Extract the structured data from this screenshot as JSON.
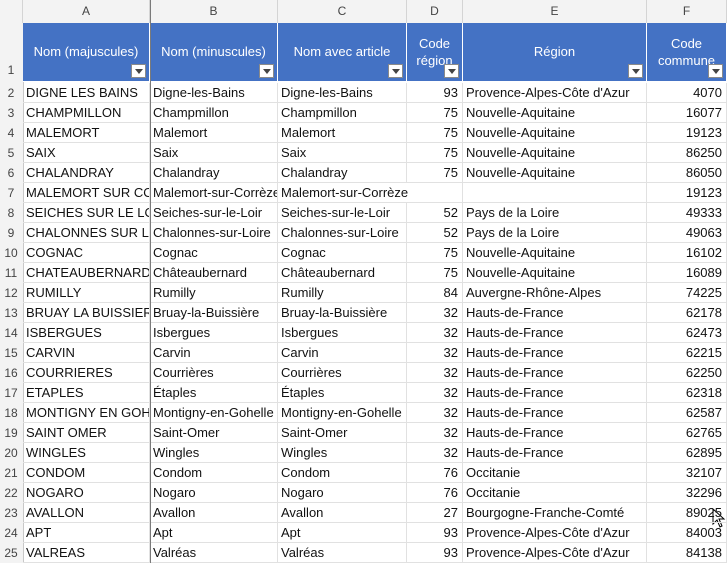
{
  "column_letters": [
    "A",
    "B",
    "C",
    "D",
    "E",
    "F"
  ],
  "headers": {
    "A": [
      "Nom (majuscules)"
    ],
    "B": [
      "Nom (minuscules)"
    ],
    "C": [
      "Nom avec article"
    ],
    "D": [
      "Code",
      "région"
    ],
    "E": [
      "Région"
    ],
    "F": [
      "Code",
      "commune"
    ]
  },
  "header_row_number": "1",
  "rows": [
    {
      "n": "2",
      "a": "DIGNE LES BAINS",
      "b": "Digne-les-Bains",
      "c": "Digne-les-Bains",
      "d": "93",
      "e": "Provence-Alpes-Côte d'Azur",
      "f": "4070"
    },
    {
      "n": "3",
      "a": "CHAMPMILLON",
      "b": "Champmillon",
      "c": "Champmillon",
      "d": "75",
      "e": "Nouvelle-Aquitaine",
      "f": "16077"
    },
    {
      "n": "4",
      "a": "MALEMORT",
      "b": "Malemort",
      "c": "Malemort",
      "d": "75",
      "e": "Nouvelle-Aquitaine",
      "f": "19123"
    },
    {
      "n": "5",
      "a": "SAIX",
      "b": "Saix",
      "c": "Saix",
      "d": "75",
      "e": "Nouvelle-Aquitaine",
      "f": "86250"
    },
    {
      "n": "6",
      "a": "CHALANDRAY",
      "b": "Chalandray",
      "c": "Chalandray",
      "d": "75",
      "e": "Nouvelle-Aquitaine",
      "f": "86050"
    },
    {
      "n": "7",
      "a": "MALEMORT SUR CORRÈZE",
      "b": "Malemort-sur-Corrèze",
      "c": "Malemort-sur-Corrèze",
      "d": "",
      "e": "",
      "f": "19123",
      "c_spill": true
    },
    {
      "n": "8",
      "a": "SEICHES SUR LE LOIR",
      "b": "Seiches-sur-le-Loir",
      "c": "Seiches-sur-le-Loir",
      "d": "52",
      "e": "Pays de la Loire",
      "f": "49333"
    },
    {
      "n": "9",
      "a": "CHALONNES SUR LOIRE",
      "b": "Chalonnes-sur-Loire",
      "c": "Chalonnes-sur-Loire",
      "d": "52",
      "e": "Pays de la Loire",
      "f": "49063"
    },
    {
      "n": "10",
      "a": "COGNAC",
      "b": "Cognac",
      "c": "Cognac",
      "d": "75",
      "e": "Nouvelle-Aquitaine",
      "f": "16102"
    },
    {
      "n": "11",
      "a": "CHATEAUBERNARD",
      "b": "Châteaubernard",
      "c": "Châteaubernard",
      "d": "75",
      "e": "Nouvelle-Aquitaine",
      "f": "16089"
    },
    {
      "n": "12",
      "a": "RUMILLY",
      "b": "Rumilly",
      "c": "Rumilly",
      "d": "84",
      "e": "Auvergne-Rhône-Alpes",
      "f": "74225"
    },
    {
      "n": "13",
      "a": "BRUAY LA BUISSIERE",
      "b": "Bruay-la-Buissière",
      "c": "Bruay-la-Buissière",
      "d": "32",
      "e": "Hauts-de-France",
      "f": "62178"
    },
    {
      "n": "14",
      "a": "ISBERGUES",
      "b": "Isbergues",
      "c": "Isbergues",
      "d": "32",
      "e": "Hauts-de-France",
      "f": "62473"
    },
    {
      "n": "15",
      "a": "CARVIN",
      "b": "Carvin",
      "c": "Carvin",
      "d": "32",
      "e": "Hauts-de-France",
      "f": "62215"
    },
    {
      "n": "16",
      "a": "COURRIERES",
      "b": "Courrières",
      "c": "Courrières",
      "d": "32",
      "e": "Hauts-de-France",
      "f": "62250"
    },
    {
      "n": "17",
      "a": "ETAPLES",
      "b": "Étaples",
      "c": "Étaples",
      "d": "32",
      "e": "Hauts-de-France",
      "f": "62318"
    },
    {
      "n": "18",
      "a": "MONTIGNY EN GOHELLE",
      "b": "Montigny-en-Gohelle",
      "c": "Montigny-en-Gohelle",
      "d": "32",
      "e": "Hauts-de-France",
      "f": "62587"
    },
    {
      "n": "19",
      "a": "SAINT OMER",
      "b": "Saint-Omer",
      "c": "Saint-Omer",
      "d": "32",
      "e": "Hauts-de-France",
      "f": "62765"
    },
    {
      "n": "20",
      "a": "WINGLES",
      "b": "Wingles",
      "c": "Wingles",
      "d": "32",
      "e": "Hauts-de-France",
      "f": "62895"
    },
    {
      "n": "21",
      "a": "CONDOM",
      "b": "Condom",
      "c": "Condom",
      "d": "76",
      "e": "Occitanie",
      "f": "32107"
    },
    {
      "n": "22",
      "a": "NOGARO",
      "b": "Nogaro",
      "c": "Nogaro",
      "d": "76",
      "e": "Occitanie",
      "f": "32296"
    },
    {
      "n": "23",
      "a": "AVALLON",
      "b": "Avallon",
      "c": "Avallon",
      "d": "27",
      "e": "Bourgogne-Franche-Comté",
      "f": "89025"
    },
    {
      "n": "24",
      "a": "APT",
      "b": "Apt",
      "c": "Apt",
      "d": "93",
      "e": "Provence-Alpes-Côte d'Azur",
      "f": "84003"
    },
    {
      "n": "25",
      "a": "VALREAS",
      "b": "Valréas",
      "c": "Valréas",
      "d": "93",
      "e": "Provence-Alpes-Côte d'Azur",
      "f": "84138"
    }
  ],
  "colors": {
    "header_bg": "#4472c4",
    "header_text": "#ffffff",
    "grid": "#e1e1e1"
  }
}
